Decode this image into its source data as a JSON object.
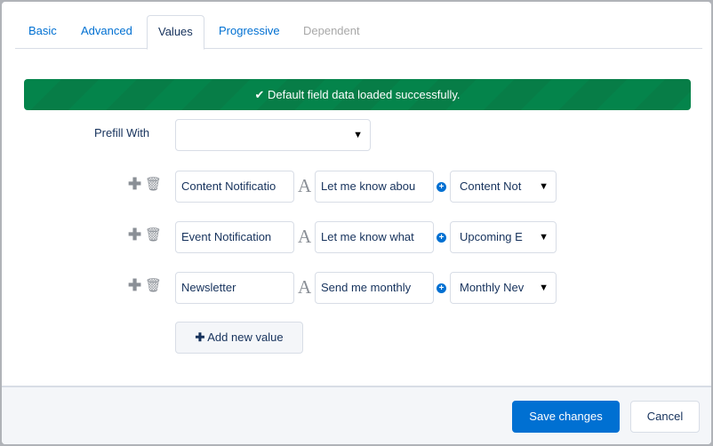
{
  "tabs": [
    {
      "label": "Basic"
    },
    {
      "label": "Advanced"
    },
    {
      "label": "Values"
    },
    {
      "label": "Progressive"
    },
    {
      "label": "Dependent"
    }
  ],
  "banner": {
    "icon": "check-circle-icon",
    "text": "Default field data loaded successfully."
  },
  "prefill": {
    "label": "Prefill With",
    "value": ""
  },
  "rows": [
    {
      "name": "Content Notificatio",
      "label": "Let me know abou",
      "select": "Content Not"
    },
    {
      "name": "Event Notification",
      "label": "Let me know what",
      "select": "Upcoming E"
    },
    {
      "name": "Newsletter",
      "label": "Send me monthly",
      "select": "Monthly Nev"
    }
  ],
  "add_value": "Add new value",
  "footer": {
    "save": "Save changes",
    "cancel": "Cancel"
  },
  "colors": {
    "accent": "#0070d2",
    "success": "#04844b"
  }
}
